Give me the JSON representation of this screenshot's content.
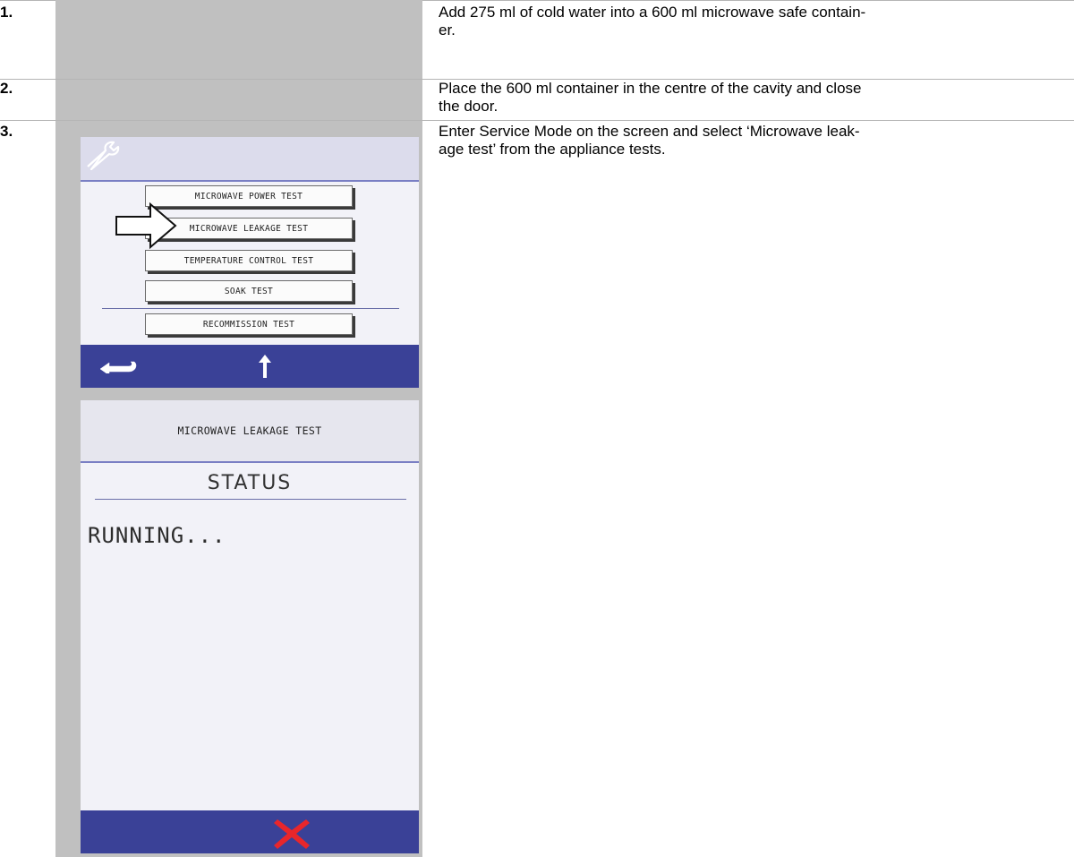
{
  "steps": [
    {
      "number": "1.",
      "text": "Add 275 ml of cold water into a 600 ml microwave safe contain-\ner."
    },
    {
      "number": "2.",
      "text": "Place the 600 ml container in the centre of the cavity and close\nthe door."
    },
    {
      "number": "3.",
      "text": "Enter Service Mode on the screen and select ‘Microwave leak-\nage test’ from the appliance tests."
    }
  ],
  "screen_menu": {
    "header_icon": "wrench-icon",
    "items": [
      "MICROWAVE POWER TEST",
      "MICROWAVE LEAKAGE TEST",
      "TEMPERATURE CONTROL TEST",
      "SOAK TEST",
      "RECOMMISSION TEST"
    ],
    "selected_item": "MICROWAVE LEAKAGE TEST",
    "footer_icons": [
      "back-icon",
      "up-arrow-icon"
    ]
  },
  "screen_status": {
    "title": "MICROWAVE LEAKAGE TEST",
    "status_label": "STATUS",
    "status_value": "RUNNING...",
    "footer_icon": "cancel-icon"
  },
  "colors": {
    "footer_blue": "#3a4197",
    "cancel_red": "#e8262b",
    "gray_cell": "#c0c0c0"
  }
}
